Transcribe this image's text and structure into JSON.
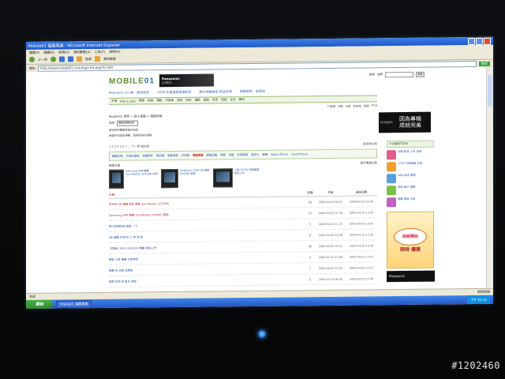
{
  "window": {
    "title": "Mobile01 電腦周邊 - Microsoft Internet Explorer",
    "menu": [
      "檔案(F)",
      "編輯(E)",
      "檢視(V)",
      "我的最愛(A)",
      "工具(T)",
      "說明(H)"
    ],
    "toolbar": {
      "back_label": "上一頁",
      "search_label": "搜尋",
      "favorites_label": "我的最愛"
    },
    "address_label": "網址",
    "address_value": "http://www.mobile01.com/topiclist.php?f=350",
    "go_label": "移至"
  },
  "site": {
    "logo_text": "MOBILE",
    "logo_num": "01",
    "logo_sub": "電腦周邊",
    "top_links": [
      "登錄",
      "註冊",
      "搜尋"
    ],
    "search_placeholder": "",
    "search_button": "搜尋",
    "banner_brand": "Panasonic",
    "banner_product": "LUMIX",
    "promos": [
      "Mobile01 2.0 網 - 我家新家",
      "2009 年度電腦周邊新品",
      "數位相機產品 新品評測",
      "網路應用 - 部落格"
    ],
    "nav_items": [
      "手機",
      "PDA & GPS",
      "筆電",
      "相機",
      "電腦",
      "汽機車",
      "居家",
      "時尚",
      "運動",
      "遊戲",
      "影音",
      "旅遊",
      "生活",
      "購物"
    ],
    "subnav_items": [
      "行事曆",
      "活動",
      "社群",
      "部落格",
      "相簿",
      "Blog"
    ]
  },
  "main": {
    "breadcrumb": "Mobile01 首頁 > 個人電腦 > 電腦周邊",
    "filter_label": "排序",
    "filter_value": "最新回應排序",
    "desc_lines": [
      "歡迎來到電腦周邊討論區",
      "請遵守討論區規範，發表前請先搜尋"
    ],
    "ad": {
      "brand": "PIONEER",
      "slogan_1": "因為專精",
      "slogan_2": "成就完美"
    },
    "pager": "1 2 3 4 5 6 7 ... 下一頁 最後頁",
    "pager_right": "發表新文章",
    "categories": [
      "電腦主機",
      "外接式硬碟",
      "週邊配件",
      "顯示器",
      "鍵盤滑鼠",
      "印表機",
      "電腦周邊",
      "網路設備",
      "軟體",
      "遊戲",
      "外接硬碟",
      "音效卡",
      "螢幕",
      "Apple iPhone",
      "SmartPhone"
    ],
    "active_category": "電腦周邊",
    "featured_title": "精選文章",
    "featured_more": "更多精選文章",
    "features": [
      "Samsung 24吋螢幕 SyncMaster 2233SW 評測",
      "ViewSonic 22吋 HD 螢幕 VX2260 開箱",
      "三星 P2350 液晶螢幕 新品上市"
    ],
    "table_headers": {
      "title": "主題",
      "replies": "回應",
      "author": "作者",
      "last": "最後回應"
    },
    "rows": [
      {
        "title": "四月份 HD 螢幕 新品 推薦 SyncMaster 2233SW",
        "replies": "41",
        "author": "2009-04-10 09:25",
        "last": "2009-04-10 14:20",
        "hot": true
      },
      {
        "title": "Samsung 24吋 螢幕 SyncMaster 2494HS 開箱",
        "replies": "11",
        "author": "2009-04-09 22:10",
        "last": "2009-04-10 13:50",
        "hot": true
      },
      {
        "title": "新USB隨身碟 推薦 一下",
        "replies": "5",
        "author": "2009-04-10 11:15",
        "last": "2009-04-10 13:42",
        "hot": false
      },
      {
        "title": "NB 螢幕 外接 有 人 用 過 嗎",
        "replies": "9",
        "author": "2009-04-08 16:30",
        "last": "2009-04-10 13:30",
        "hot": false
      },
      {
        "title": "【開箱】ASUS VH222H 螢幕 使用心得",
        "replies": "26",
        "author": "2009-04-05 20:12",
        "last": "2009-04-10 13:18",
        "hot": false
      },
      {
        "title": "購買 三星 螢幕 注意事項",
        "replies": "3",
        "author": "2009-04-10 12:00",
        "last": "2009-04-10 13:05",
        "hot": false
      },
      {
        "title": "螢幕 有 亮點 怎麼辦",
        "replies": "7",
        "author": "2009-04-09 10:45",
        "last": "2009-04-10 12:57",
        "hot": false
      },
      {
        "title": "推薦 好用 的 藍牙 滑鼠",
        "replies": "2",
        "author": "2009-04-10 08:30",
        "last": "2009-04-10 12:40",
        "hot": false
      }
    ]
  },
  "right": {
    "header": "今日最熱門文章",
    "items": [
      "手機 新品 上市 消息",
      "2.5吋 外接硬碟 比較",
      "NAS 設定 教學",
      "無線 網卡 推薦",
      "電腦 組裝 分享"
    ],
    "ad_text": "限時 優惠",
    "ad_bubble": "即將開始",
    "ad2_text": "Panasonic"
  },
  "status": {
    "text": "完成",
    "zone": "網際網路"
  },
  "taskbar": {
    "start_label": "開始",
    "task_label": "Mobile01 電腦周邊",
    "clock": "下午 01:45"
  },
  "watermark": "#1202460",
  "colors": {
    "accent": "#5b8a2f",
    "link": "#2b5ca8",
    "hot": "#b03030",
    "titlebar": "#1e58c8"
  }
}
